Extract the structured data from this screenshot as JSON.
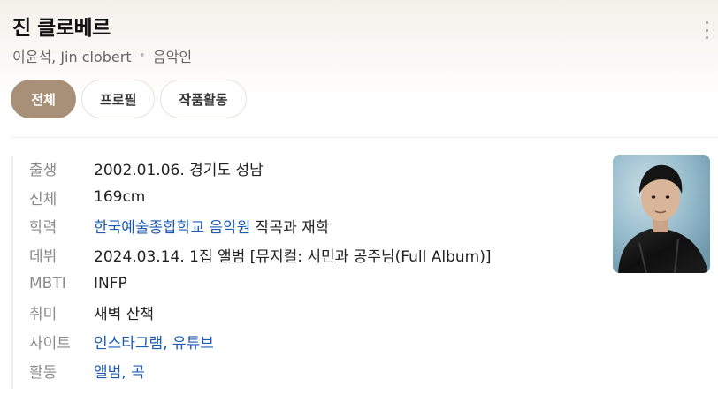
{
  "profile": {
    "name": "진 클로베르",
    "aliases": "이윤석, Jin clobert",
    "occupation": "음악인"
  },
  "tabs": [
    {
      "label": "전체",
      "active": true
    },
    {
      "label": "프로필",
      "active": false
    },
    {
      "label": "작품활동",
      "active": false
    }
  ],
  "info": {
    "birth": {
      "key": "출생",
      "value": "2002.01.06. 경기도 성남"
    },
    "height": {
      "key": "신체",
      "value": "169cm"
    },
    "education": {
      "key": "학력",
      "link": "한국예술종합학교 음악원",
      "rest": " 작곡과 재학"
    },
    "debut": {
      "key": "데뷔",
      "value": "2024.03.14. 1집 앨범 [뮤지컬: 서민과 공주님(Full Album)]"
    },
    "mbti": {
      "key": "MBTI",
      "value": "INFP"
    },
    "hobby": {
      "key": "취미",
      "value": "새벽 산책"
    },
    "sites": {
      "key": "사이트",
      "link1": "인스타그램",
      "sep": ", ",
      "link2": "유튜브"
    },
    "activity": {
      "key": "활동",
      "link1": "앨범",
      "sep": ", ",
      "link2": "곡"
    }
  },
  "icons": {
    "more": "more-vertical-icon"
  },
  "colors": {
    "accent_tab": "#a88f77",
    "link": "#1b5bb5",
    "label": "#8a8a8a"
  }
}
